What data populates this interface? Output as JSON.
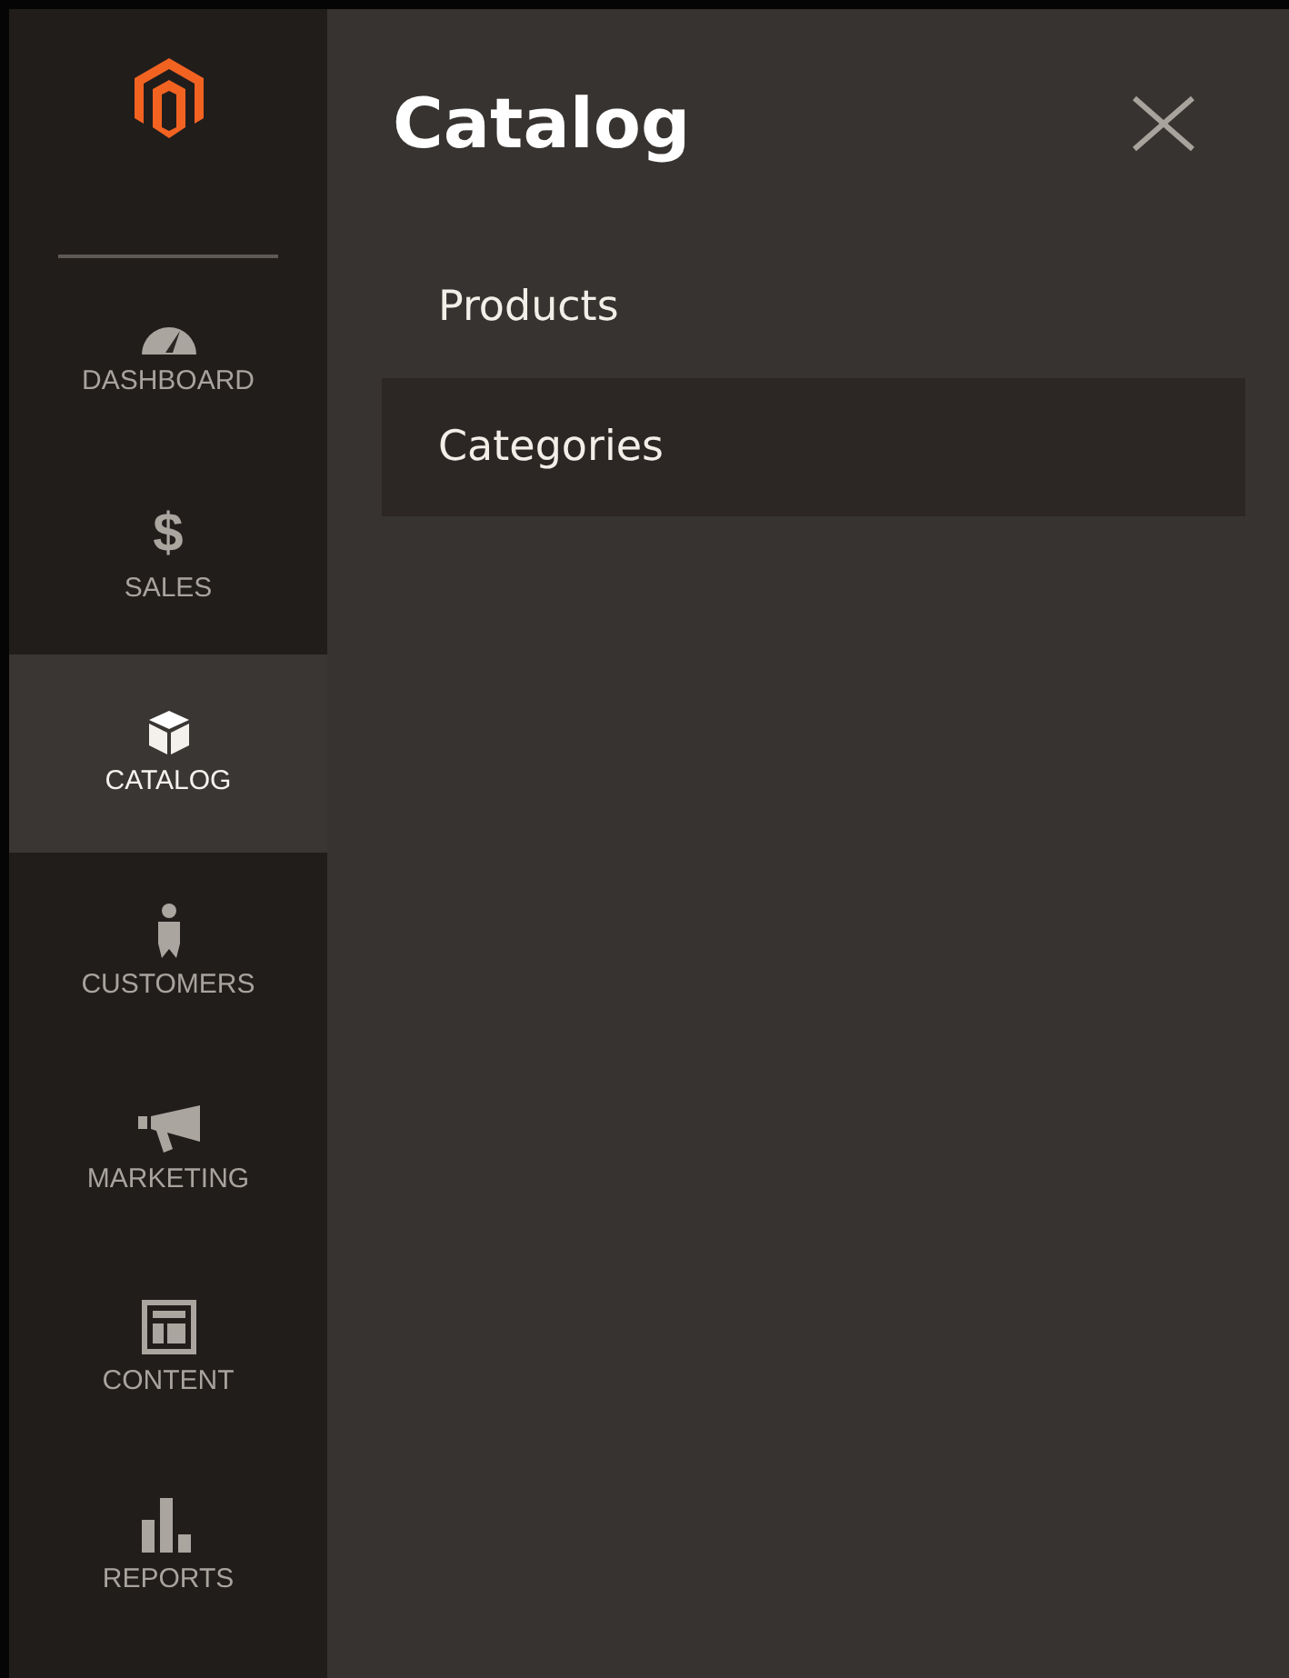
{
  "sidebar": {
    "items": [
      {
        "kind": "dashboard",
        "label": "DASHBOARD",
        "selected": false
      },
      {
        "kind": "sales",
        "label": "SALES",
        "icon_text": "$",
        "selected": false
      },
      {
        "kind": "catalog",
        "label": "CATALOG",
        "selected": true
      },
      {
        "kind": "customers",
        "label": "CUSTOMERS",
        "selected": false
      },
      {
        "kind": "marketing",
        "label": "MARKETING",
        "selected": false
      },
      {
        "kind": "content",
        "label": "CONTENT",
        "selected": false
      },
      {
        "kind": "reports",
        "label": "REPORTS",
        "selected": false
      }
    ]
  },
  "panel": {
    "title": "Catalog",
    "items": [
      {
        "label": "Products",
        "selected": false
      },
      {
        "label": "Categories",
        "selected": true
      }
    ]
  }
}
